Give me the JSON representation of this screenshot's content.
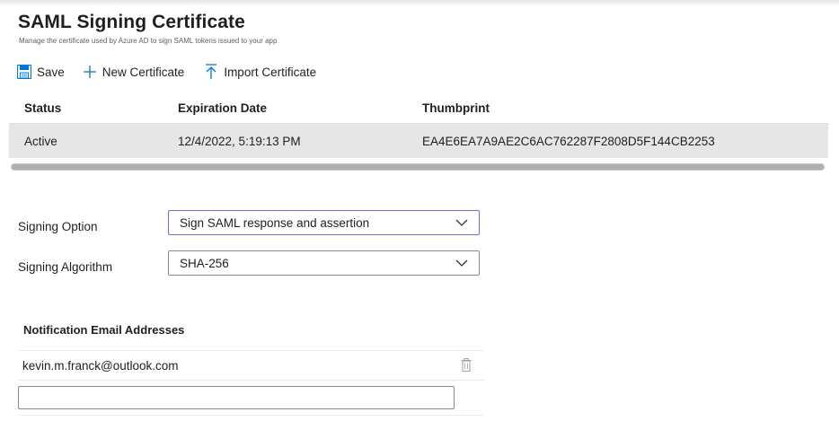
{
  "header": {
    "title": "SAML Signing Certificate",
    "subtitle": "Manage the certificate used by Azure AD to sign SAML tokens issued to your app"
  },
  "toolbar": {
    "save_label": "Save",
    "new_certificate_label": "New Certificate",
    "import_certificate_label": "Import Certificate"
  },
  "certificate_table": {
    "columns": [
      "Status",
      "Expiration Date",
      "Thumbprint"
    ],
    "rows": [
      {
        "status": "Active",
        "expiration_date": "12/4/2022, 5:19:13 PM",
        "thumbprint": "EA4E6EA7A9AE2C6AC762287F2808D5F144CB2253"
      }
    ]
  },
  "signing": {
    "option_label": "Signing Option",
    "option_value": "Sign SAML response and assertion",
    "algorithm_label": "Signing Algorithm",
    "algorithm_value": "SHA-256"
  },
  "notification": {
    "title": "Notification Email Addresses",
    "emails": [
      "kevin.m.franck@outlook.com"
    ],
    "new_email_value": ""
  },
  "icons": {
    "save": "save-icon",
    "new": "plus-icon",
    "import": "upload-arrow-icon",
    "dropdown": "chevron-down-icon",
    "delete": "trash-icon"
  },
  "colors": {
    "accent": "#0078d4",
    "focus_border": "#8764b8",
    "selected_row": "#e6e6e6"
  }
}
